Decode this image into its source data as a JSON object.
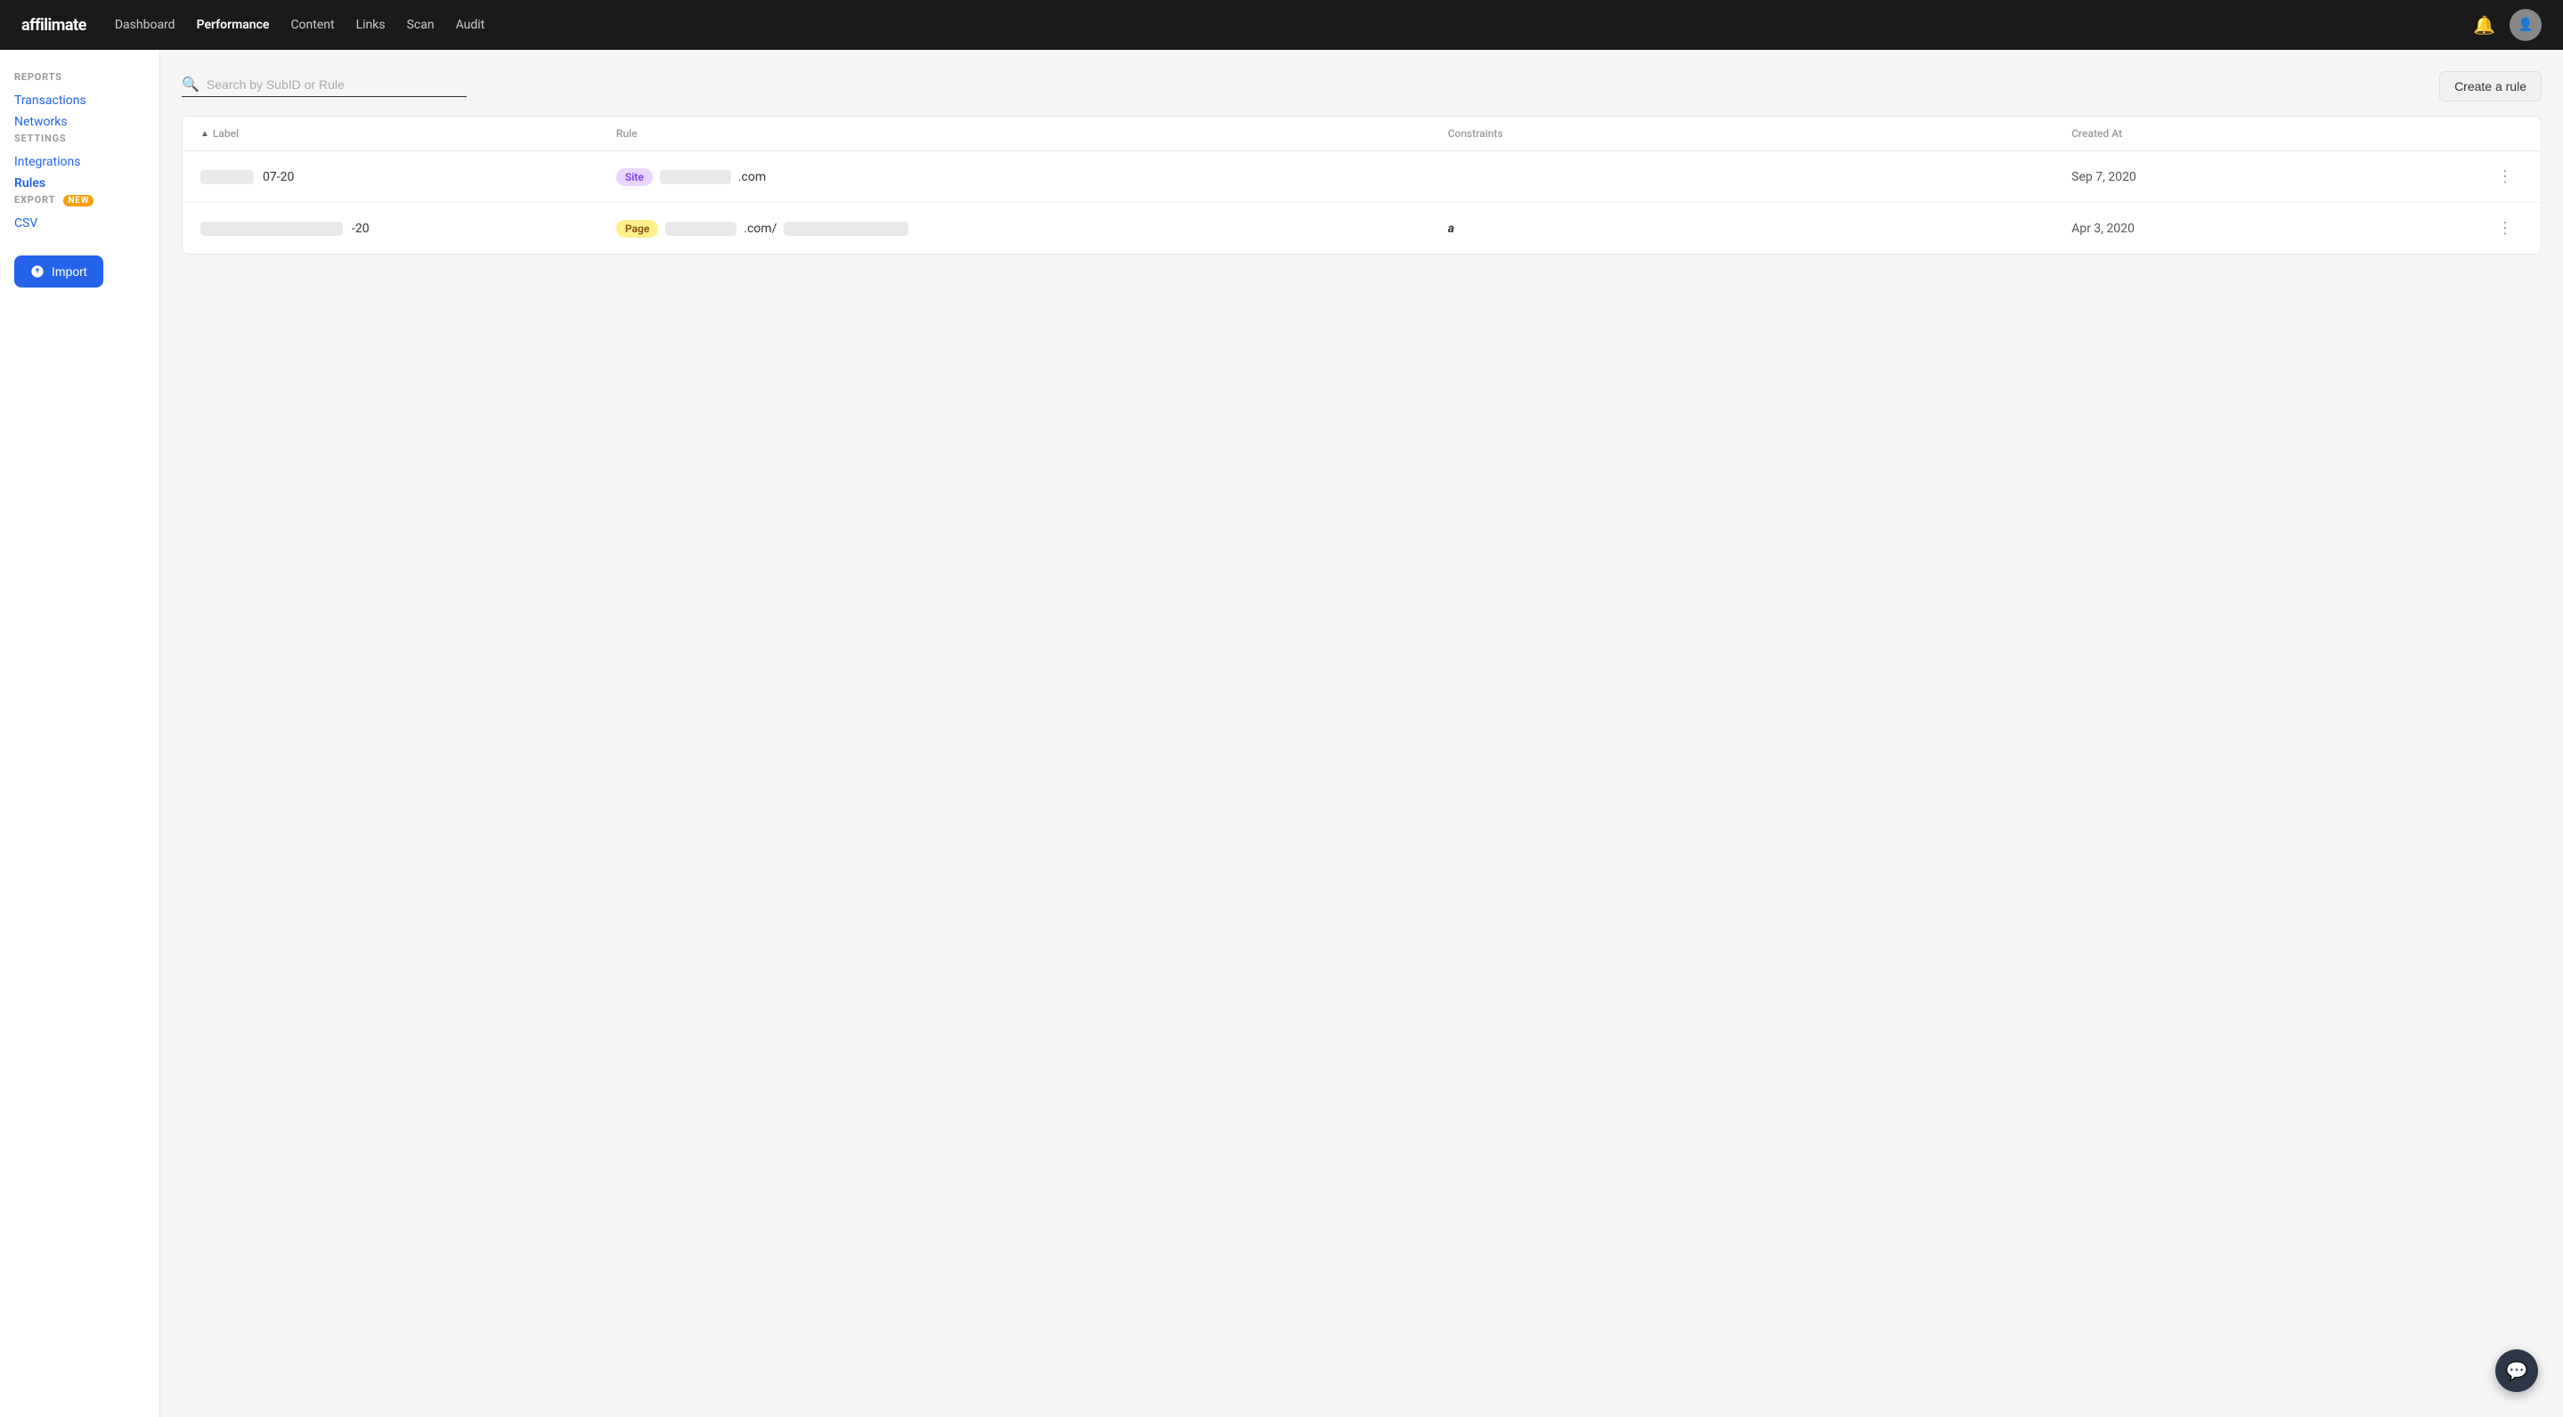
{
  "brand": {
    "logo": "affilimate"
  },
  "topnav": {
    "links": [
      {
        "label": "Dashboard",
        "active": false
      },
      {
        "label": "Performance",
        "active": true
      },
      {
        "label": "Content",
        "active": false
      },
      {
        "label": "Links",
        "active": false
      },
      {
        "label": "Scan",
        "active": false
      },
      {
        "label": "Audit",
        "active": false
      }
    ]
  },
  "sidebar": {
    "sections": [
      {
        "title": "REPORTS",
        "items": [
          {
            "label": "Transactions",
            "active": false
          },
          {
            "label": "Networks",
            "active": false
          }
        ]
      },
      {
        "title": "SETTINGS",
        "items": [
          {
            "label": "Integrations",
            "active": false
          },
          {
            "label": "Rules",
            "active": true
          }
        ]
      },
      {
        "title": "EXPORT",
        "badge": "NEW",
        "items": [
          {
            "label": "CSV",
            "active": false
          }
        ]
      }
    ],
    "import_button": "Import"
  },
  "toolbar": {
    "search_placeholder": "Search by SubID or Rule",
    "create_rule_label": "Create a rule"
  },
  "table": {
    "columns": [
      "Label",
      "Rule",
      "Constraints",
      "Created At"
    ],
    "rows": [
      {
        "label_prefix_width": 60,
        "label_suffix": "07-20",
        "rule_type": "Site",
        "rule_type_class": "site",
        "rule_url_prefix_width": 80,
        "rule_url_suffix": ".com",
        "constraints": [],
        "created_at": "Sep 7, 2020"
      },
      {
        "label_prefix_width": 160,
        "label_suffix": "-20",
        "rule_type": "Page",
        "rule_type_class": "page",
        "rule_url_prefix_width": 80,
        "rule_url_suffix": ".com/",
        "rule_url_suffix2_width": 140,
        "constraints": [
          "amazon"
        ],
        "created_at": "Apr 3, 2020"
      }
    ]
  },
  "chat": {
    "icon": "💬"
  }
}
